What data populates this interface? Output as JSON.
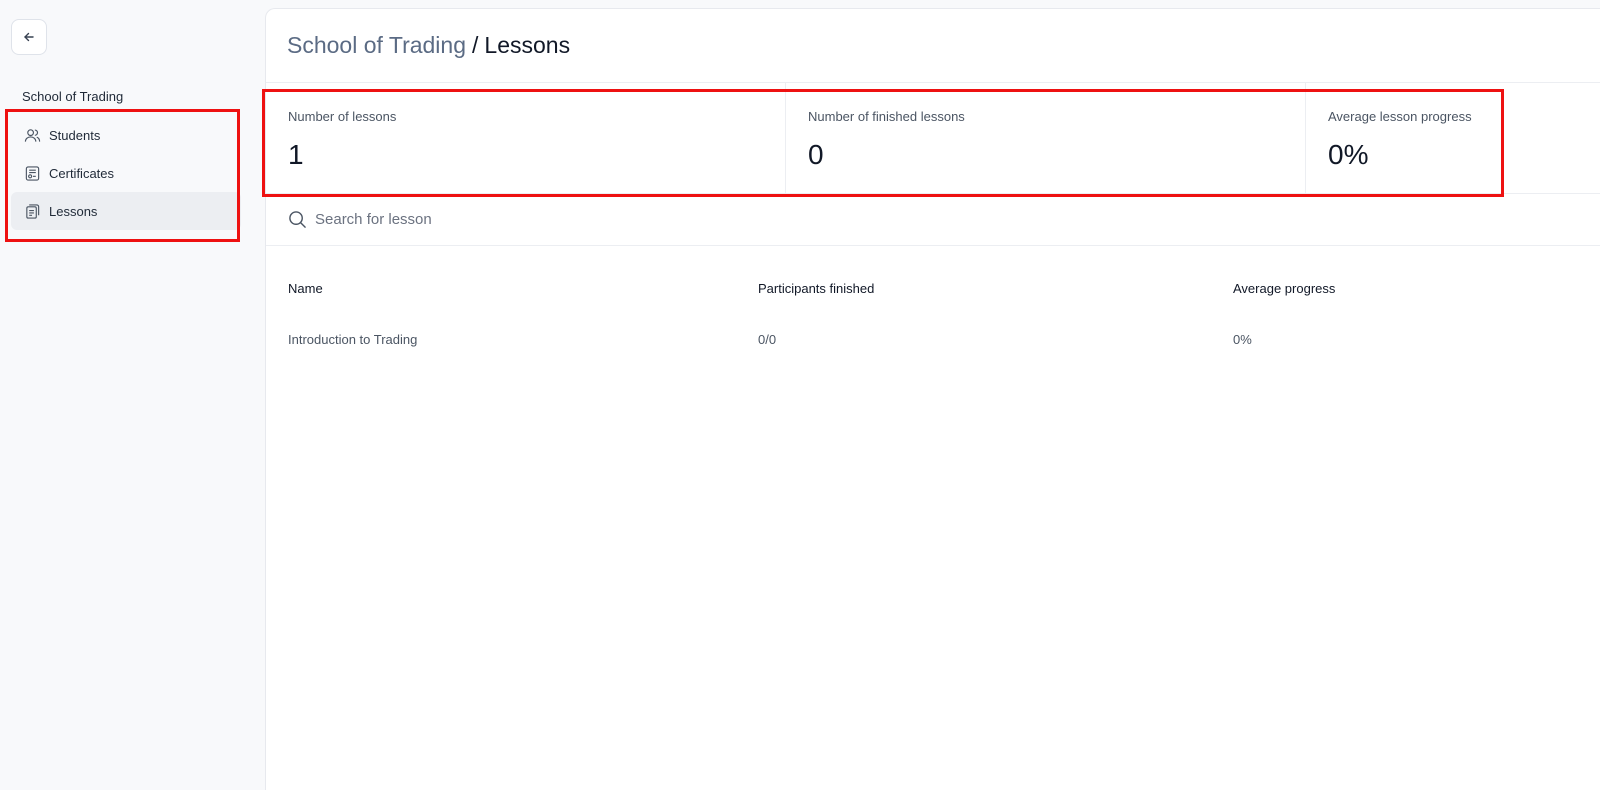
{
  "sidebar": {
    "org_name": "School of Trading",
    "items": [
      {
        "label": "Students",
        "icon": "users-icon"
      },
      {
        "label": "Certificates",
        "icon": "certificate-icon"
      },
      {
        "label": "Lessons",
        "icon": "lessons-icon",
        "active": true
      }
    ]
  },
  "header": {
    "breadcrumb_parent": "School of Trading",
    "separator": "/",
    "breadcrumb_current": "Lessons"
  },
  "stats": [
    {
      "label": "Number of lessons",
      "value": "1"
    },
    {
      "label": "Number of finished lessons",
      "value": "0"
    },
    {
      "label": "Average lesson progress",
      "value": "0%"
    }
  ],
  "search": {
    "placeholder": "Search for lesson",
    "value": ""
  },
  "table": {
    "columns": [
      "Name",
      "Participants finished",
      "Average progress"
    ],
    "rows": [
      [
        "Introduction to Trading",
        "0/0",
        "0%"
      ]
    ]
  },
  "colors": {
    "highlight": "#ee1111",
    "active_nav_bg": "#eceef2",
    "breadcrumb_link": "#5b6b84"
  }
}
